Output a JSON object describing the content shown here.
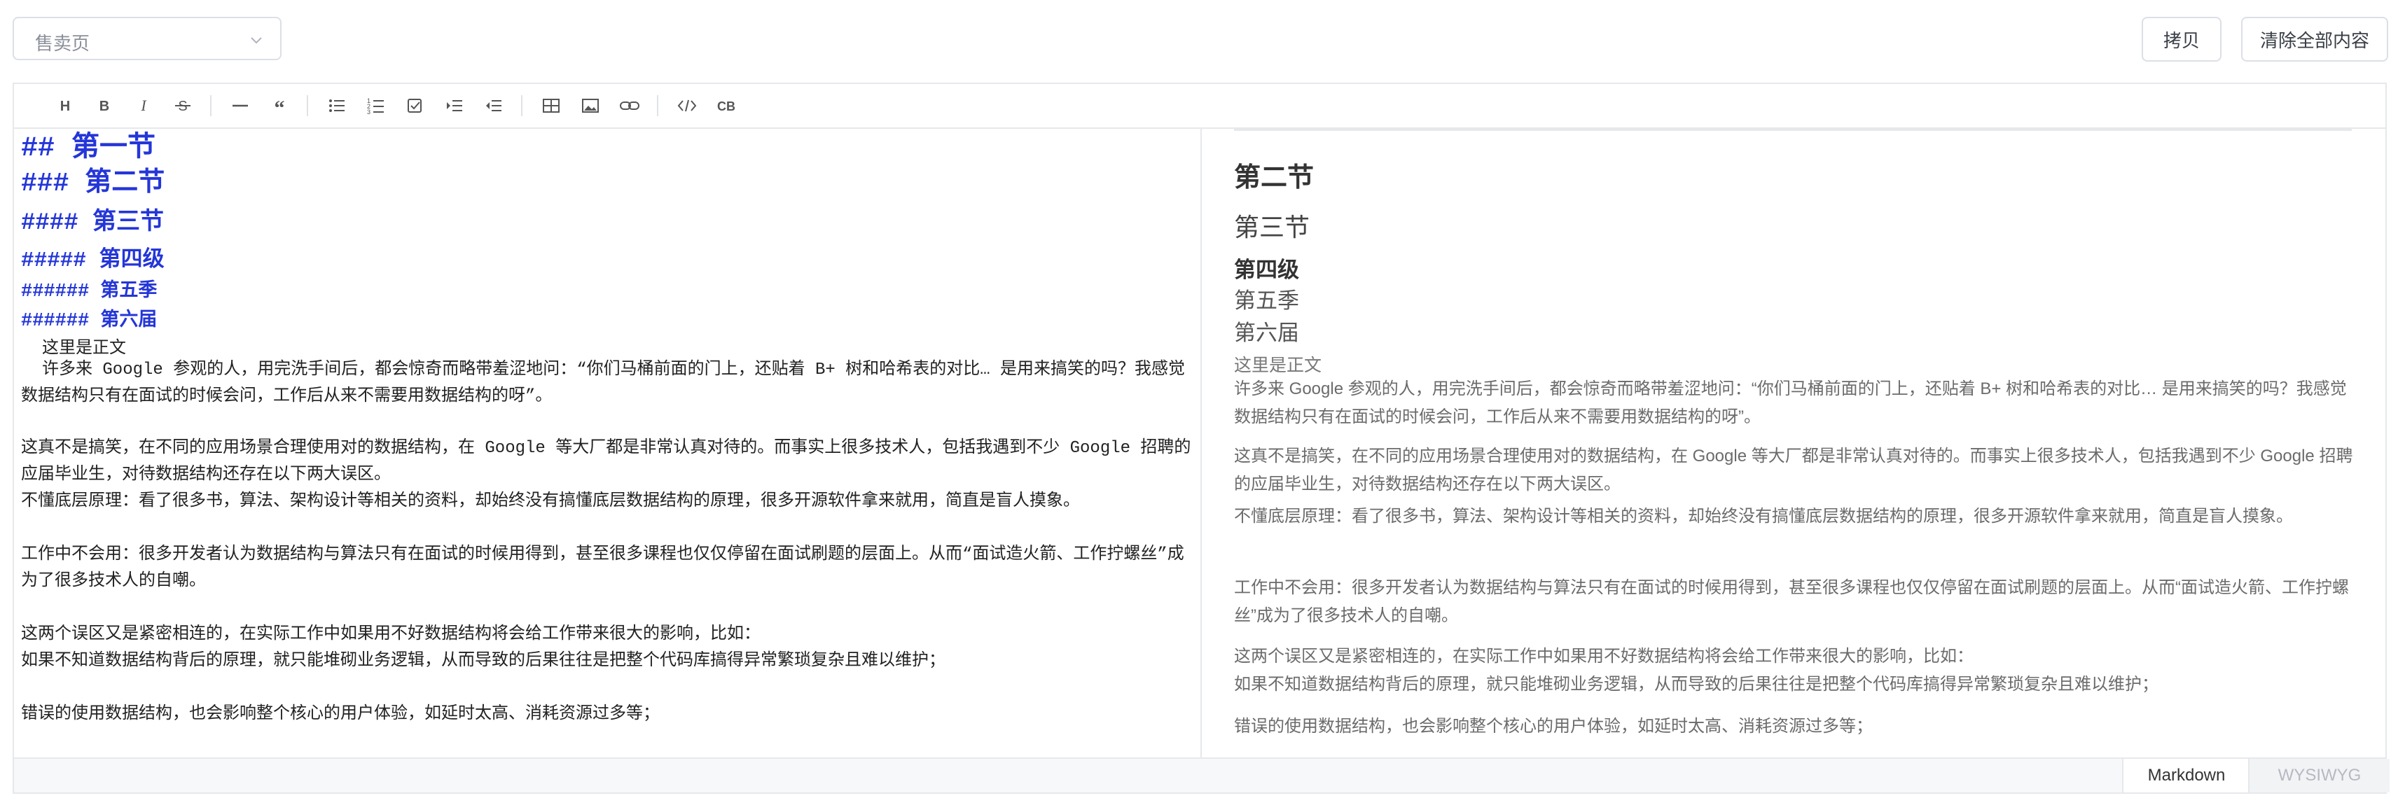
{
  "page_select": {
    "value": "售卖页"
  },
  "actions": {
    "copy": "拷贝",
    "clear_all": "清除全部内容"
  },
  "toolbar": {
    "icons": [
      "heading-icon",
      "bold-icon",
      "italic-icon",
      "strikethrough-icon",
      "horizontal-rule-icon",
      "blockquote-icon",
      "bullet-list-icon",
      "ordered-list-icon",
      "task-list-icon",
      "indent-icon",
      "outdent-icon",
      "table-icon",
      "image-icon",
      "link-icon",
      "code-icon",
      "code-block-icon"
    ],
    "labels": [
      "H",
      "B",
      "I",
      "S",
      "—",
      "❝",
      "•≡",
      "1≡",
      "☑",
      "→≡",
      "←≡",
      "▦",
      "▣",
      "🔗",
      "</>",
      "CB"
    ]
  },
  "markdown": {
    "h2": "## 第一节",
    "h3": "### 第二节",
    "h4": "#### 第三节",
    "h5": "##### 第四级",
    "h6a": "###### 第五季",
    "h6b": "###### 第六届",
    "line1": "这里是正文",
    "para1": "许多来 Google 参观的人，用完洗手间后，都会惊奇而略带羞涩地问：“你们马桶前面的门上，还贴着 B+ 树和哈希表的对比… 是用来搞笑的吗？我感觉数据结构只有在面试的时候会问，工作后从来不需要用数据结构的呀”。",
    "para2": "这真不是搞笑，在不同的应用场景合理使用对的数据结构，在 Google 等大厂都是非常认真对待的。而事实上很多技术人，包括我遇到不少 Google 招聘的应届毕业生，对待数据结构还存在以下两大误区。",
    "para3": "不懂底层原理：看了很多书，算法、架构设计等相关的资料，却始终没有搞懂底层数据结构的原理，很多开源软件拿来就用，简直是盲人摸象。",
    "para4": "工作中不会用：很多开发者认为数据结构与算法只有在面试的时候用得到，甚至很多课程也仅仅停留在面试刷题的层面上。从而“面试造火箭、工作拧螺丝”成为了很多技术人的自嘲。",
    "para5a": "这两个误区又是紧密相连的，在实际工作中如果用不好数据结构将会给工作带来很大的影响，比如：",
    "para5b": "如果不知道数据结构背后的原理，就只能堆砌业务逻辑，从而导致的后果往往是把整个代码库搞得异常繁琐复杂且难以维护；",
    "para6": "错误的使用数据结构，也会影响整个核心的用户体验，如延时太高、消耗资源过多等；"
  },
  "preview": {
    "h3": "第二节",
    "h4": "第三节",
    "h5": "第四级",
    "h6a": "第五季",
    "h6b": "第六届",
    "line1": "这里是正文",
    "para1": "许多来 Google 参观的人，用完洗手间后，都会惊奇而略带羞涩地问：“你们马桶前面的门上，还贴着 B+ 树和哈希表的对比… 是用来搞笑的吗？我感觉数据结构只有在面试的时候会问，工作后从来不需要用数据结构的呀”。",
    "para2": "这真不是搞笑，在不同的应用场景合理使用对的数据结构，在 Google 等大厂都是非常认真对待的。而事实上很多技术人，包括我遇到不少 Google 招聘的应届毕业生，对待数据结构还存在以下两大误区。",
    "para3": "不懂底层原理：看了很多书，算法、架构设计等相关的资料，却始终没有搞懂底层数据结构的原理，很多开源软件拿来就用，简直是盲人摸象。",
    "para4": "工作中不会用：很多开发者认为数据结构与算法只有在面试的时候用得到，甚至很多课程也仅仅停留在面试刷题的层面上。从而“面试造火箭、工作拧螺丝”成为了很多技术人的自嘲。",
    "para5a": "这两个误区又是紧密相连的，在实际工作中如果用不好数据结构将会给工作带来很大的影响，比如：",
    "para5b": "如果不知道数据结构背后的原理，就只能堆砌业务逻辑，从而导致的后果往往是把整个代码库搞得异常繁琐复杂且难以维护；",
    "para6": "错误的使用数据结构，也会影响整个核心的用户体验，如延时太高、消耗资源过多等；"
  },
  "mode_tabs": {
    "markdown": "Markdown",
    "wysiwyg": "WYSIWYG",
    "active": "Markdown"
  }
}
